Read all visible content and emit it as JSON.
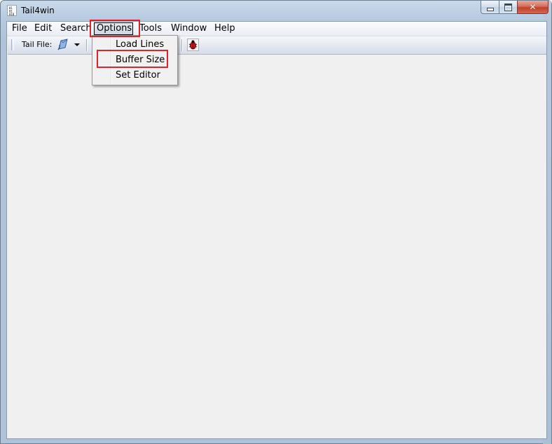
{
  "window": {
    "title": "Tail4win",
    "icon_bits": "0 1\n0 1\n0 1 0",
    "close_glyph": "✕"
  },
  "menu_bar": {
    "items": [
      {
        "label": "File"
      },
      {
        "label": "Edit"
      },
      {
        "label": "Search"
      },
      {
        "label": "Options"
      },
      {
        "label": "Tools"
      },
      {
        "label": "Window"
      },
      {
        "label": "Help"
      }
    ],
    "active_item": "Options"
  },
  "toolbar": {
    "tail_file_label": "Tail File:",
    "icons": [
      "file-open-icon",
      "dropdown-arrow-icon",
      "bug-icon"
    ]
  },
  "options_menu": {
    "items": [
      {
        "label": "Load Lines"
      },
      {
        "label": "Buffer Size"
      },
      {
        "label": "Set Editor"
      }
    ]
  },
  "colors": {
    "highlight": "#e0222c",
    "frame": "#aec3da",
    "client_bg": "#f0f0f0"
  }
}
